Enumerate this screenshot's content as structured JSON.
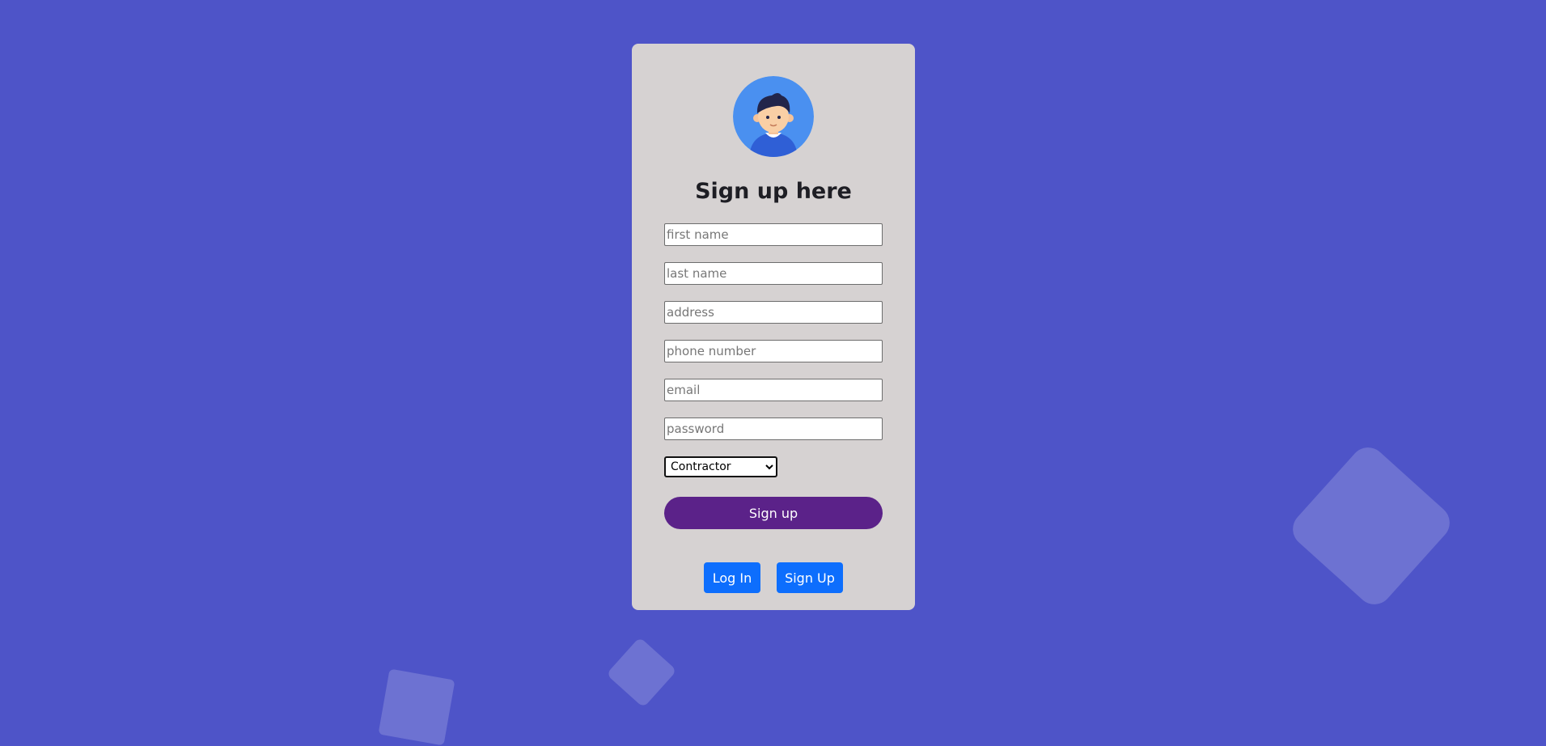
{
  "form": {
    "title": "Sign up here",
    "fields": {
      "first_name": {
        "placeholder": "first name",
        "value": ""
      },
      "last_name": {
        "placeholder": "last name",
        "value": ""
      },
      "address": {
        "placeholder": "address",
        "value": ""
      },
      "phone": {
        "placeholder": "phone number",
        "value": ""
      },
      "email": {
        "placeholder": "email",
        "value": ""
      },
      "password": {
        "placeholder": "password",
        "value": ""
      }
    },
    "role_select": {
      "selected": "Contractor",
      "options": [
        "Contractor"
      ]
    },
    "submit_label": "Sign up"
  },
  "nav": {
    "login_label": "Log In",
    "signup_label": "Sign Up"
  },
  "colors": {
    "background": "#4e54c8",
    "card": "#d6d2d2",
    "submit_button": "#5b2289",
    "nav_button": "#0d6efd",
    "avatar_circle": "#4a90f0"
  },
  "icons": {
    "avatar": "user-avatar-icon",
    "select_arrow": "chevron-down-icon"
  }
}
